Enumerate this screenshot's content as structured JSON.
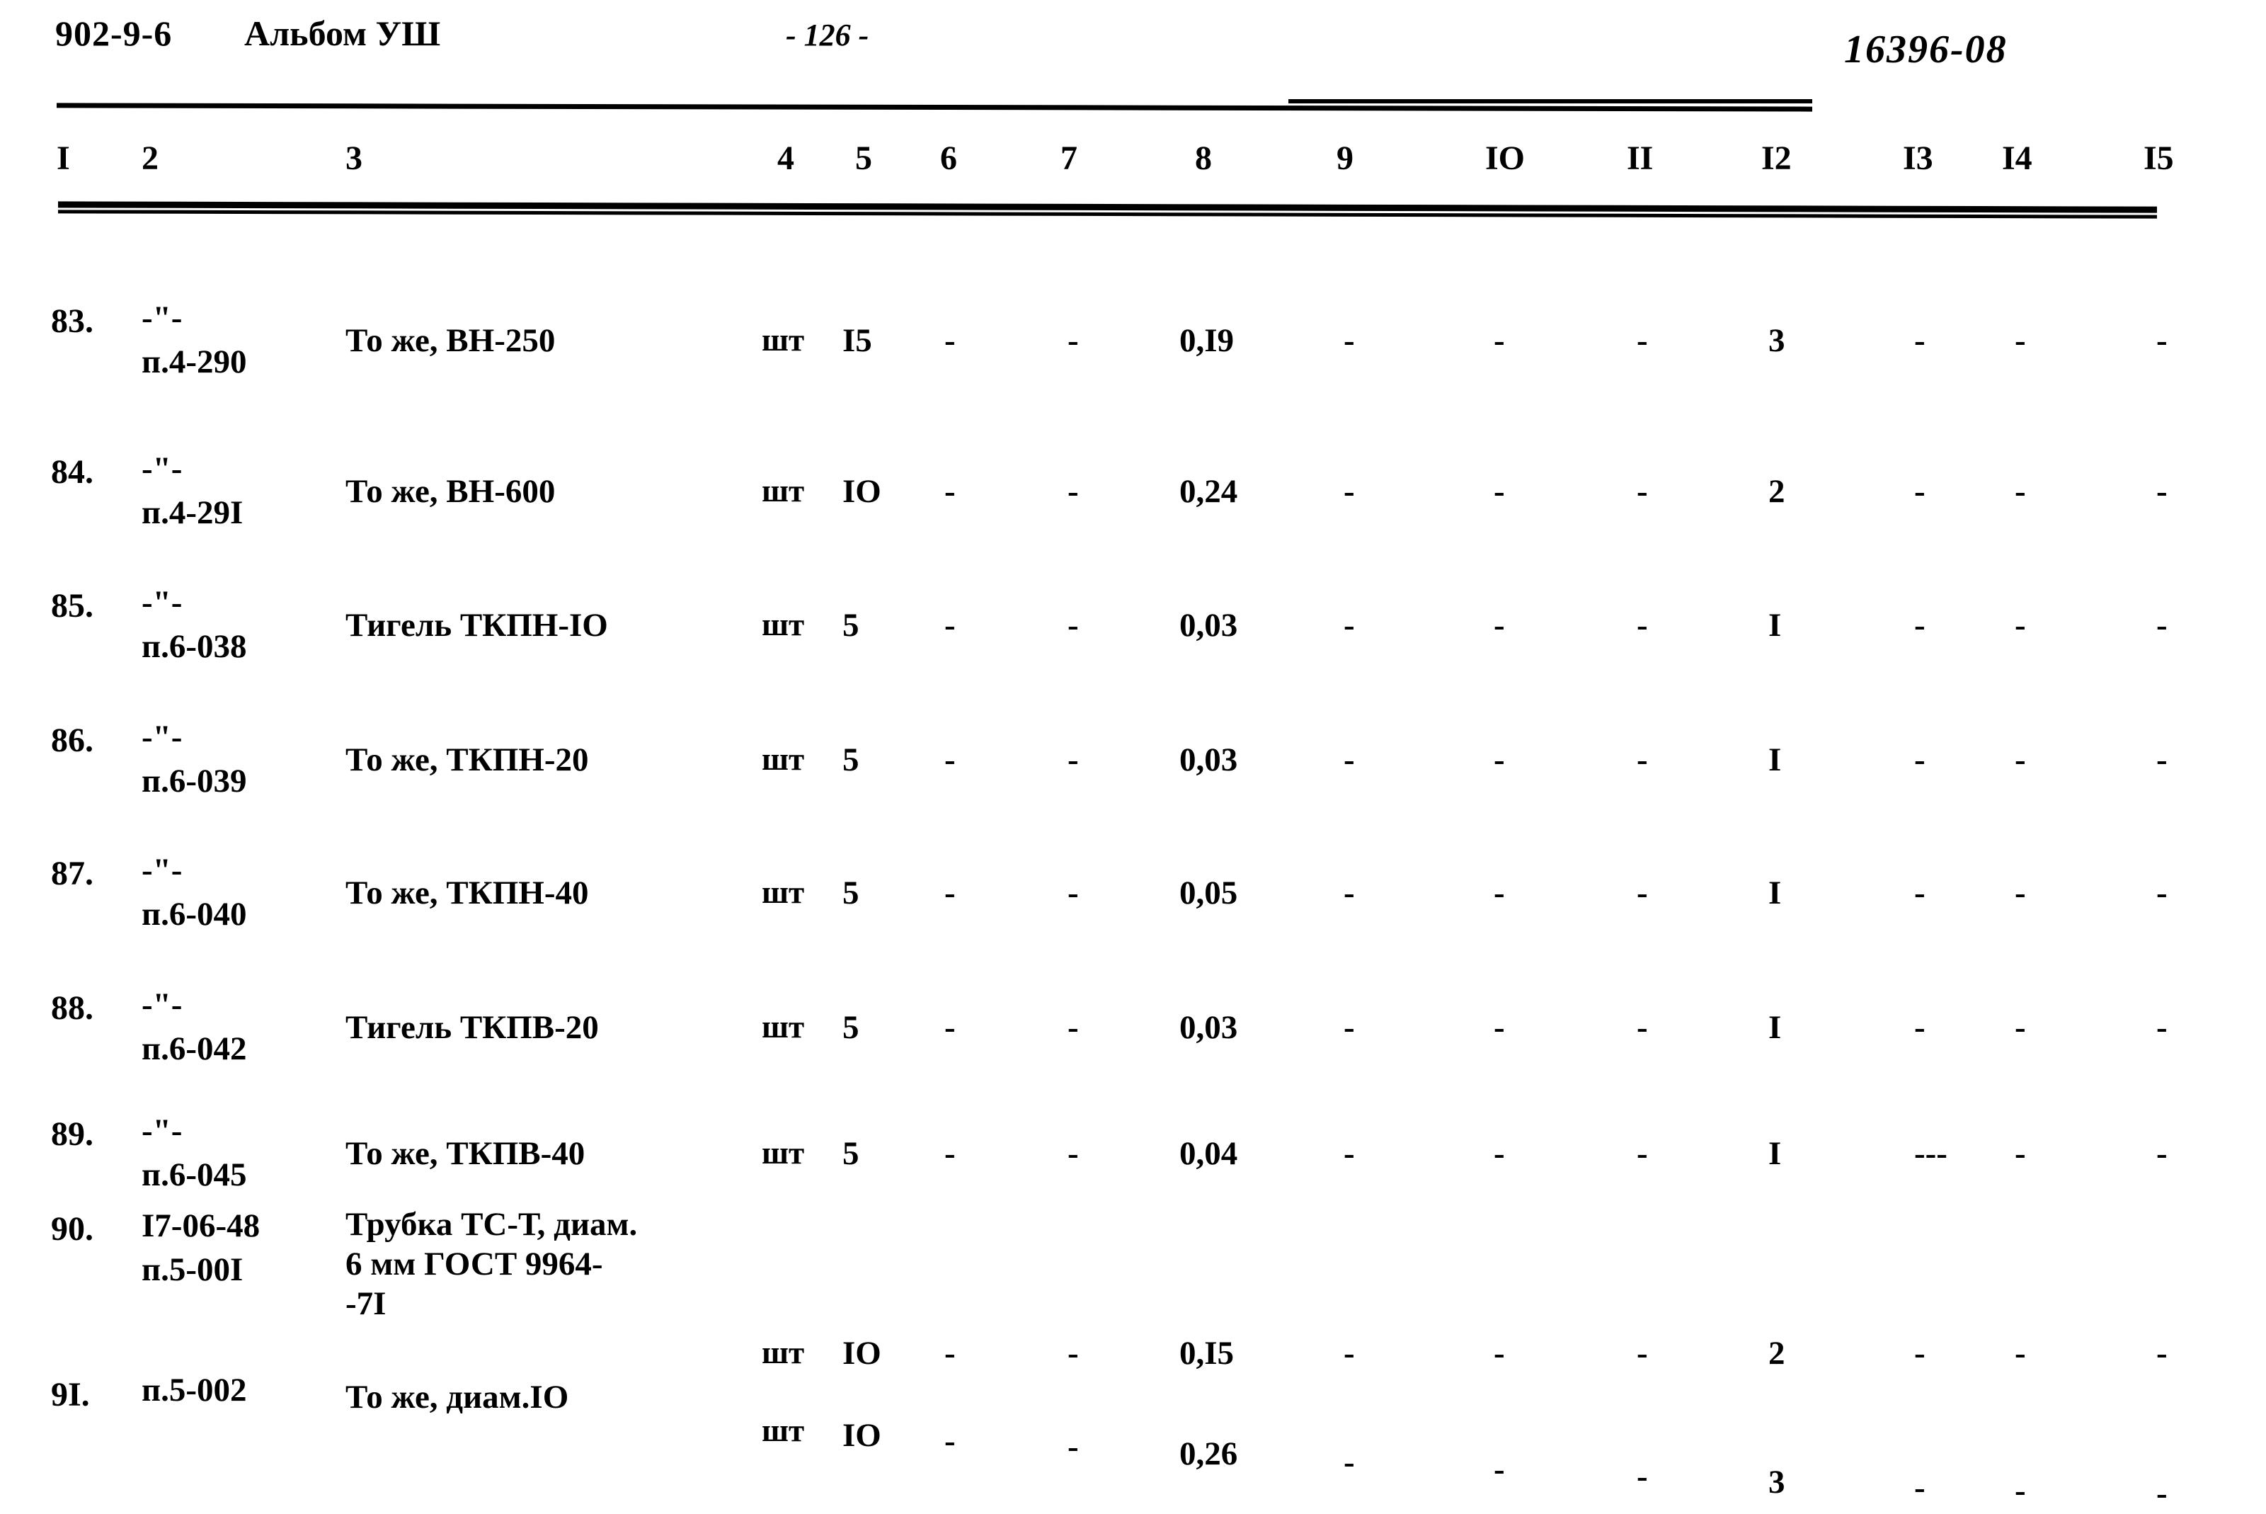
{
  "header": {
    "doc_code": "902-9-6",
    "album": "Альбом УШ",
    "page_number": "- 126 -",
    "stamp": "16396-08"
  },
  "table": {
    "column_headers": [
      "I",
      "2",
      "3",
      "4",
      "5",
      "6",
      "7",
      "8",
      "9",
      "IO",
      "II",
      "I2",
      "I3",
      "I4",
      "I5"
    ],
    "rows": [
      {
        "num": "83.",
        "code_line1": "-\"-",
        "code_line2": "п.4-290",
        "code_line3": "",
        "name_line1": "То же, ВН-250",
        "name_line2": "",
        "name_line3": "",
        "unit": "шт",
        "c5": "I5",
        "c6": "-",
        "c7": "-",
        "c8": "0,I9",
        "c9": "-",
        "c10": "-",
        "c11": "-",
        "c12": "3",
        "c13": "-",
        "c14": "-",
        "c15": "-"
      },
      {
        "num": "84.",
        "code_line1": "-\"-",
        "code_line2": "п.4-29I",
        "code_line3": "",
        "name_line1": "То же, ВН-600",
        "name_line2": "",
        "name_line3": "",
        "unit": "шт",
        "c5": "IO",
        "c6": "-",
        "c7": "-",
        "c8": "0,24",
        "c9": "-",
        "c10": "-",
        "c11": "-",
        "c12": "2",
        "c13": "-",
        "c14": "-",
        "c15": "-"
      },
      {
        "num": "85.",
        "code_line1": "-\"-",
        "code_line2": "п.6-038",
        "code_line3": "",
        "name_line1": "Тигель ТКПН-IO",
        "name_line2": "",
        "name_line3": "",
        "unit": "шт",
        "c5": "5",
        "c6": "-",
        "c7": "-",
        "c8": "0,03",
        "c9": "-",
        "c10": "-",
        "c11": "-",
        "c12": "I",
        "c13": "-",
        "c14": "-",
        "c15": "-"
      },
      {
        "num": "86.",
        "code_line1": "-\"-",
        "code_line2": "п.6-039",
        "code_line3": "",
        "name_line1": "То же, ТКПН-20",
        "name_line2": "",
        "name_line3": "",
        "unit": "шт",
        "c5": "5",
        "c6": "-",
        "c7": "-",
        "c8": "0,03",
        "c9": "-",
        "c10": "-",
        "c11": "-",
        "c12": "I",
        "c13": "-",
        "c14": "-",
        "c15": "-"
      },
      {
        "num": "87.",
        "code_line1": "-\"-",
        "code_line2": "п.6-040",
        "code_line3": "",
        "name_line1": "То же, ТКПН-40",
        "name_line2": "",
        "name_line3": "",
        "unit": "шт",
        "c5": "5",
        "c6": "-",
        "c7": "-",
        "c8": "0,05",
        "c9": "-",
        "c10": "-",
        "c11": "-",
        "c12": "I",
        "c13": "-",
        "c14": "-",
        "c15": "-"
      },
      {
        "num": "88.",
        "code_line1": "-\"-",
        "code_line2": "п.6-042",
        "code_line3": "",
        "name_line1": "Тигель ТКПВ-20",
        "name_line2": "",
        "name_line3": "",
        "unit": "шт",
        "c5": "5",
        "c6": "-",
        "c7": "-",
        "c8": "0,03",
        "c9": "-",
        "c10": "-",
        "c11": "-",
        "c12": "I",
        "c13": "-",
        "c14": "-",
        "c15": "-"
      },
      {
        "num": "89.",
        "code_line1": "-\"-",
        "code_line2": "п.6-045",
        "code_line3": "",
        "name_line1": "То же, ТКПВ-40",
        "name_line2": "",
        "name_line3": "",
        "unit": "шт",
        "c5": "5",
        "c6": "-",
        "c7": "-",
        "c8": "0,04",
        "c9": "-",
        "c10": "-",
        "c11": "-",
        "c12": "I",
        "c13": "---",
        "c14": "-",
        "c15": "-"
      },
      {
        "num": "90.",
        "code_line1": "I7-06-48",
        "code_line2": "п.5-00I",
        "code_line3": "",
        "name_line1": "Трубка ТС-Т, диам.",
        "name_line2": "6 мм ГОСТ 9964-",
        "name_line3": "-7I",
        "unit": "шт",
        "c5": "IO",
        "c6": "-",
        "c7": "-",
        "c8": "0,I5",
        "c9": "-",
        "c10": "-",
        "c11": "-",
        "c12": "2",
        "c13": "-",
        "c14": "-",
        "c15": "-"
      },
      {
        "num": "9I.",
        "code_line1": "п.5-002",
        "code_line2": "",
        "code_line3": "",
        "name_line1": "То же, диам.IO",
        "name_line2": "",
        "name_line3": "",
        "unit": "шт",
        "c5": "IO",
        "c6": "-",
        "c7": "-",
        "c8": "0,26",
        "c9": "-",
        "c10": "-",
        "c11": "-",
        "c12": "3",
        "c13": "-",
        "c14": "-",
        "c15": "-"
      }
    ]
  }
}
